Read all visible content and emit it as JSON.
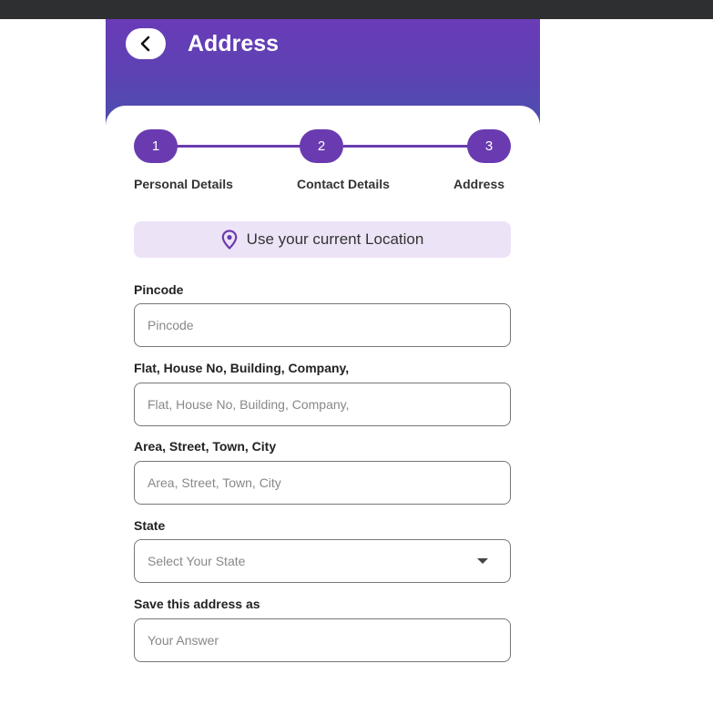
{
  "header": {
    "title": "Address"
  },
  "stepper": {
    "steps": [
      {
        "number": "1",
        "label": "Personal Details"
      },
      {
        "number": "2",
        "label": "Contact Details"
      },
      {
        "number": "3",
        "label": "Address"
      }
    ]
  },
  "location": {
    "label": "Use your current Location"
  },
  "form": {
    "pincode": {
      "label": "Pincode",
      "placeholder": "Pincode"
    },
    "flat": {
      "label": "Flat, House No, Building, Company,",
      "placeholder": "Flat, House No, Building, Company,"
    },
    "area": {
      "label": "Area, Street, Town, City",
      "placeholder": "Area, Street, Town, City"
    },
    "state": {
      "label": "State",
      "placeholder": "Select Your State"
    },
    "save_as": {
      "label": "Save this address as",
      "placeholder": "Your Answer"
    }
  },
  "colors": {
    "accent": "#6a3bb0",
    "header_top": "#6a3bb7",
    "header_bottom": "#4c50ad",
    "location_bg": "#ede3f7",
    "status_bar": "#2e2f31"
  },
  "icons": {
    "back": "chevron-left-icon",
    "location": "location-pin-icon",
    "dropdown": "caret-down-icon"
  }
}
